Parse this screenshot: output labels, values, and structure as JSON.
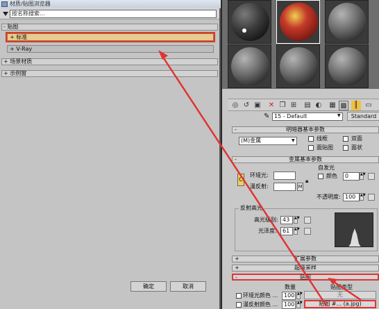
{
  "browser": {
    "title": "材质/贴图浏览器",
    "search_placeholder": "按名称搜索...",
    "groups": [
      {
        "label": "- 贴图"
      },
      {
        "label": "+ 场景材质"
      },
      {
        "label": "+ 示例窗"
      }
    ],
    "items": [
      {
        "label": "+ 标准"
      },
      {
        "label": "+ V-Ray"
      }
    ],
    "ok_label": "确定",
    "cancel_label": "取消"
  },
  "material": {
    "name": "15 - Default",
    "type_label": "Standard",
    "shader_rollup": "明暗器基本参数",
    "shader_type": "(M)金属",
    "wire": "线框",
    "two_sided": "双面",
    "face_map": "面贴图",
    "faceted": "面状",
    "metal_rollup": "金属基本参数",
    "self_illum": "自发光",
    "ambient": "环境光:",
    "diffuse": "漫反射:",
    "lock_c": "C",
    "map_m": "M",
    "color_label": "颜色",
    "color_value": "0",
    "opacity_label": "不透明度:",
    "opacity_value": "100",
    "specular_group": "反射高光",
    "spec_level_label": "高光级别:",
    "spec_level_value": "43",
    "gloss_label": "光泽度:",
    "gloss_value": "61",
    "extended_rollup": "扩展参数",
    "supersampling_rollup": "超级采样",
    "maps_rollup": "贴图",
    "amount_header": "数量",
    "map_type_header": "贴图类型",
    "rows": [
      {
        "label": "环境光颜色 ...",
        "amount": "100",
        "map": "无"
      },
      {
        "label": "漫反射颜色 ...",
        "amount": "100",
        "map": "贴图 #... (a.jpg)"
      }
    ]
  },
  "colors": {
    "accent_red": "#e03434",
    "highlight": "#e6cc90"
  }
}
